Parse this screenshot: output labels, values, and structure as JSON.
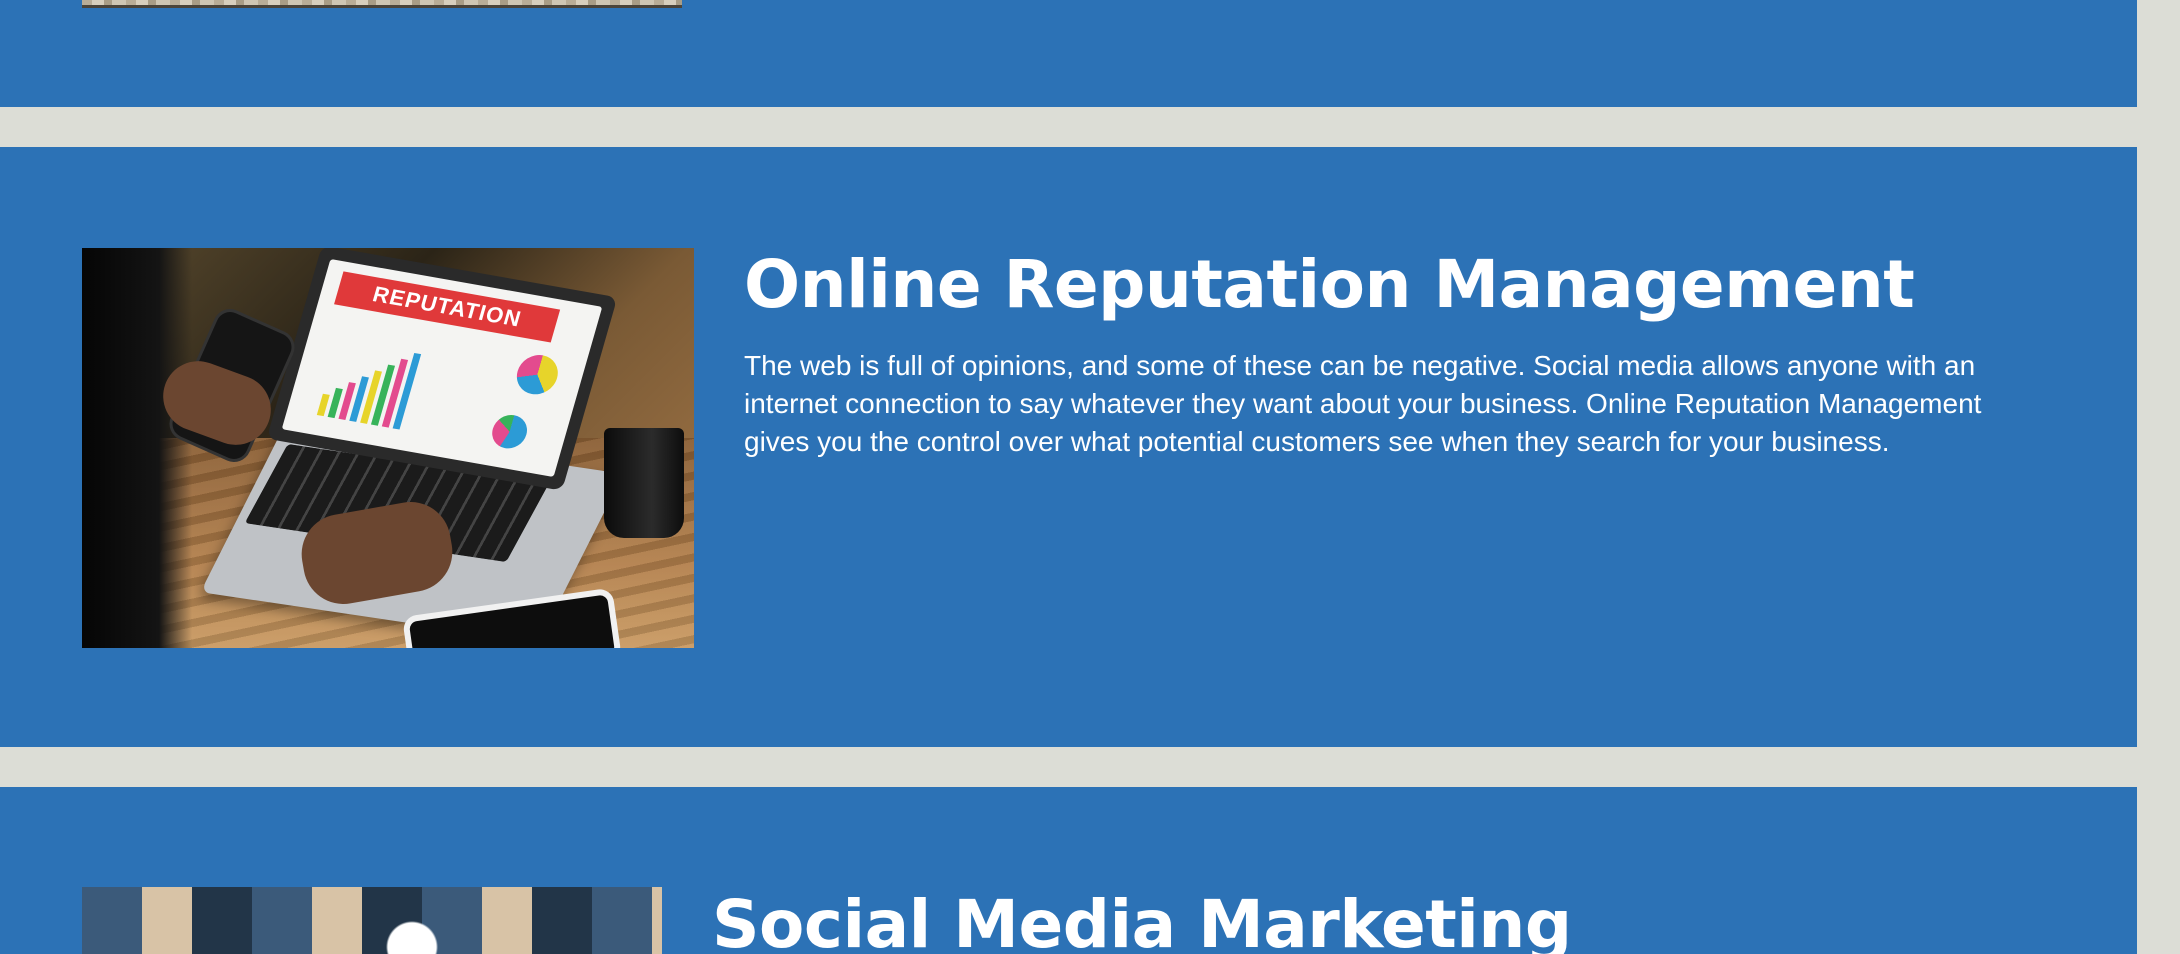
{
  "sections": {
    "orm": {
      "title": "Online Reputation Management",
      "body": "The web is full of opinions, and some of these can be negative. Social media allows anyone with an internet connection to say whatever they want about your business. Online Reputation Management gives you the control over what potential customers see when they search for your business.",
      "image_caption_text": "REPUTATION"
    },
    "smm": {
      "title": "Social Media Marketing"
    }
  },
  "colors": {
    "section_background": "#2c72b6",
    "page_background": "#dcddd6",
    "text": "#ffffff",
    "reputation_banner": "#e0393a"
  }
}
